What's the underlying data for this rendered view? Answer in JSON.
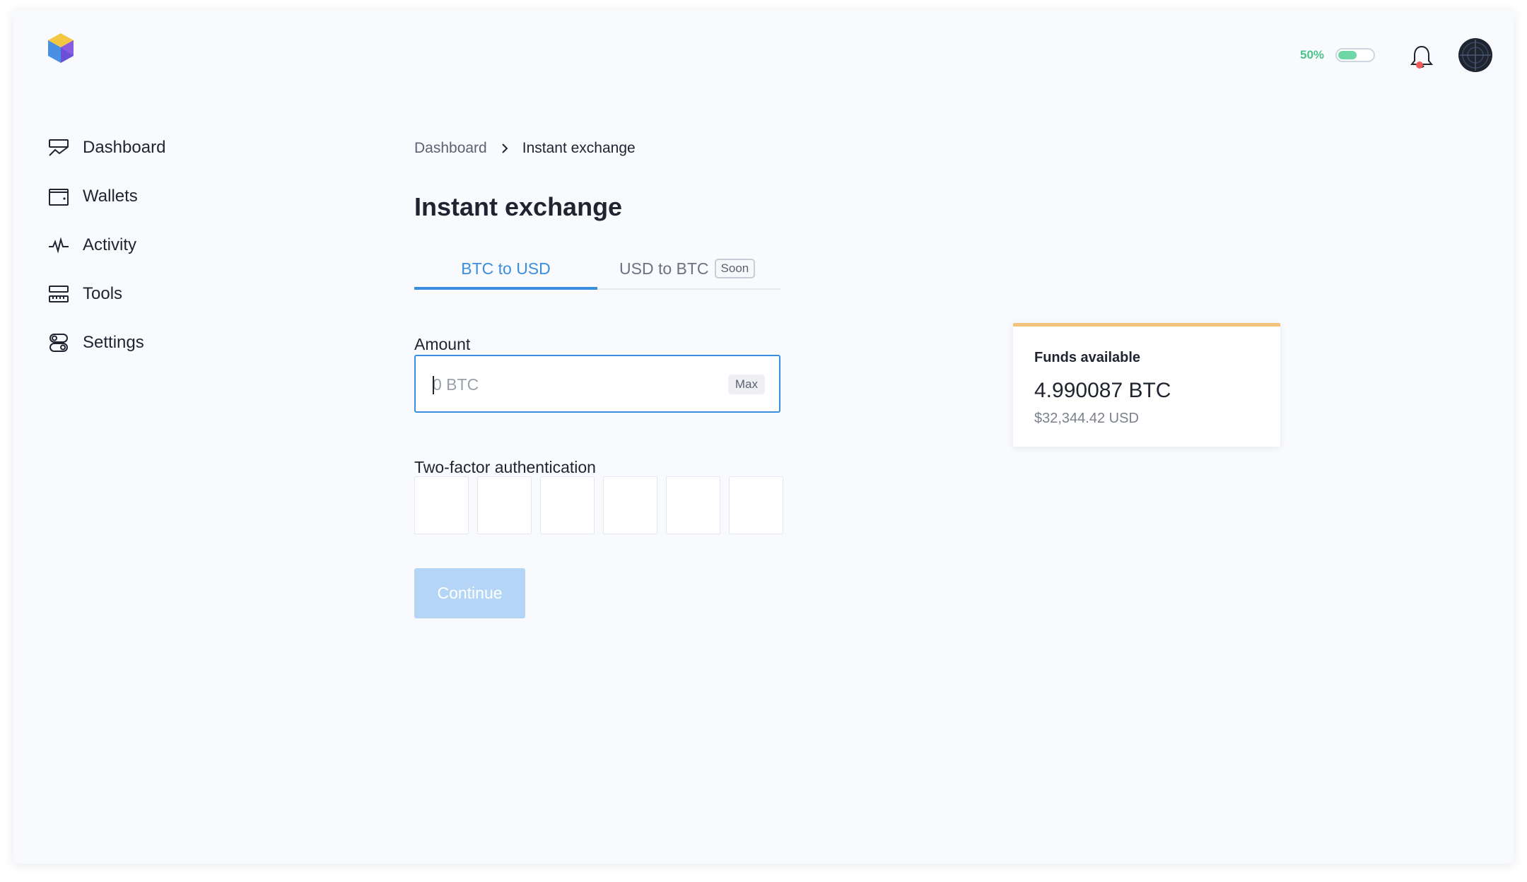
{
  "topbar": {
    "percent": "50%",
    "toggle_fill": 0.5,
    "notification_dot_color": "#ef5a5a"
  },
  "sidebar": {
    "items": [
      {
        "label": "Dashboard",
        "icon": "dashboard-icon"
      },
      {
        "label": "Wallets",
        "icon": "wallet-icon"
      },
      {
        "label": "Activity",
        "icon": "activity-icon"
      },
      {
        "label": "Tools",
        "icon": "tools-icon"
      },
      {
        "label": "Settings",
        "icon": "settings-icon"
      }
    ]
  },
  "breadcrumb": {
    "parent": "Dashboard",
    "current": "Instant exchange"
  },
  "page": {
    "title": "Instant exchange"
  },
  "tabs": {
    "active": "BTC to USD",
    "inactive": "USD to BTC",
    "inactive_badge": "Soon"
  },
  "form": {
    "amount_label": "Amount",
    "amount_placeholder": "0 BTC",
    "max_label": "Max",
    "twofa_label": "Two-factor authentication",
    "continue_label": "Continue"
  },
  "funds": {
    "title": "Funds available",
    "btc": "4.990087 BTC",
    "usd": "$32,344.42 USD"
  },
  "colors": {
    "accent": "#3a8ee0",
    "success": "#4cc38a",
    "card_accent": "#f5c27a"
  }
}
